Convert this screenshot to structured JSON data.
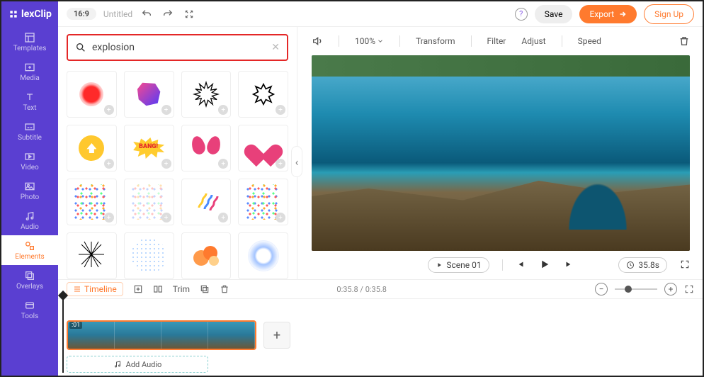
{
  "logo": "lexClip",
  "topbar": {
    "ratio": "16:9",
    "title": "Untitled",
    "save": "Save",
    "export": "Export",
    "signup": "Sign Up"
  },
  "sidebar": [
    {
      "label": "Templates",
      "icon": "templates"
    },
    {
      "label": "Media",
      "icon": "media"
    },
    {
      "label": "Text",
      "icon": "text"
    },
    {
      "label": "Subtitle",
      "icon": "subtitle"
    },
    {
      "label": "Video",
      "icon": "video"
    },
    {
      "label": "Photo",
      "icon": "photo"
    },
    {
      "label": "Audio",
      "icon": "audio"
    },
    {
      "label": "Elements",
      "icon": "elements",
      "active": true
    },
    {
      "label": "Overlays",
      "icon": "overlays"
    },
    {
      "label": "Tools",
      "icon": "tools"
    }
  ],
  "search": {
    "value": "explosion"
  },
  "preview": {
    "zoom": "100%",
    "transform": "Transform",
    "filter": "Filter",
    "adjust": "Adjust",
    "speed": "Speed",
    "scene_label": "Scene 01",
    "duration": "35.8s"
  },
  "timeline": {
    "tab": "Timeline",
    "trim": "Trim",
    "time": "0:35.8 / 0:35.8",
    "clip_label": ":01",
    "add_audio": "Add Audio"
  }
}
